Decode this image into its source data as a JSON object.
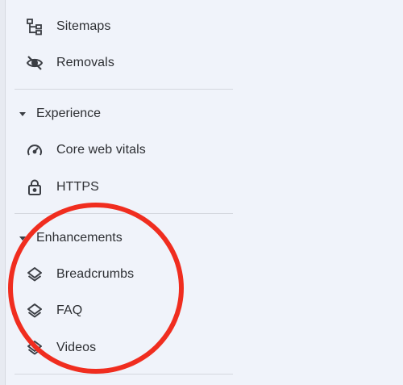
{
  "nav": {
    "sitemaps": {
      "label": "Sitemaps",
      "icon": "sitemap-icon"
    },
    "removals": {
      "label": "Removals",
      "icon": "eye-off-icon"
    }
  },
  "experience": {
    "header": "Experience",
    "items": [
      {
        "label": "Core web vitals",
        "icon": "speedometer-icon"
      },
      {
        "label": "HTTPS",
        "icon": "lock-icon"
      }
    ]
  },
  "enhancements": {
    "header": "Enhancements",
    "items": [
      {
        "label": "Breadcrumbs",
        "icon": "layers-icon"
      },
      {
        "label": "FAQ",
        "icon": "layers-icon"
      },
      {
        "label": "Videos",
        "icon": "layers-icon"
      }
    ]
  },
  "colors": {
    "background": "#f0f3fa",
    "text": "#2d2f33",
    "annotation": "#f02d1f"
  }
}
